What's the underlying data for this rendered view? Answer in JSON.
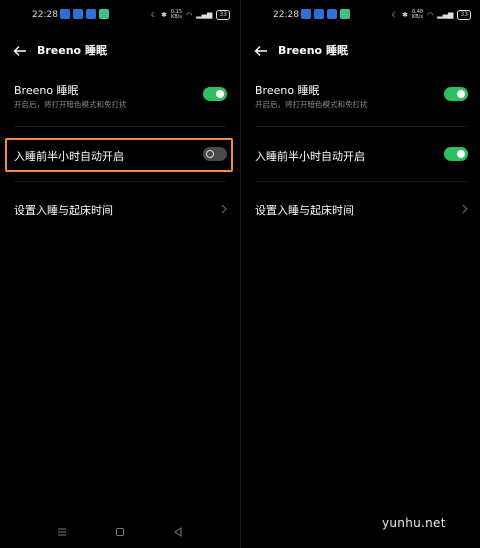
{
  "status_bar": [
    {
      "time": "22:28",
      "speed": "0.15\nKB/s",
      "battery": "33"
    },
    {
      "time": "22:28",
      "speed": "0.48\nKB/s",
      "battery": "33"
    }
  ],
  "screens": [
    {
      "header": {
        "title": "Breeno 睡眠"
      },
      "items": [
        {
          "label": "Breeno 睡眠",
          "subtitle": "开启后，将打开暗色模式和免打扰",
          "toggle": "on"
        },
        {
          "label": "入睡前半小时自动开启",
          "toggle": "off",
          "highlighted": true
        },
        {
          "label": "设置入睡与起床时间",
          "chevron": true
        }
      ],
      "navbar": [
        "menu-icon",
        "home-icon",
        "back-triangle-icon"
      ]
    },
    {
      "header": {
        "title": "Breeno 睡眠"
      },
      "items": [
        {
          "label": "Breeno 睡眠",
          "subtitle": "开启后，将打开暗色模式和免打扰",
          "toggle": "on"
        },
        {
          "label": "入睡前半小时自动开启",
          "toggle": "on"
        },
        {
          "label": "设置入睡与起床时间",
          "chevron": true
        }
      ]
    }
  ],
  "colors": {
    "toggle_on": "#2fbf62",
    "toggle_off": "#4a4a4a",
    "highlight_border": "#f08a4b",
    "background": "#000000"
  },
  "watermark": "yunhu.net"
}
